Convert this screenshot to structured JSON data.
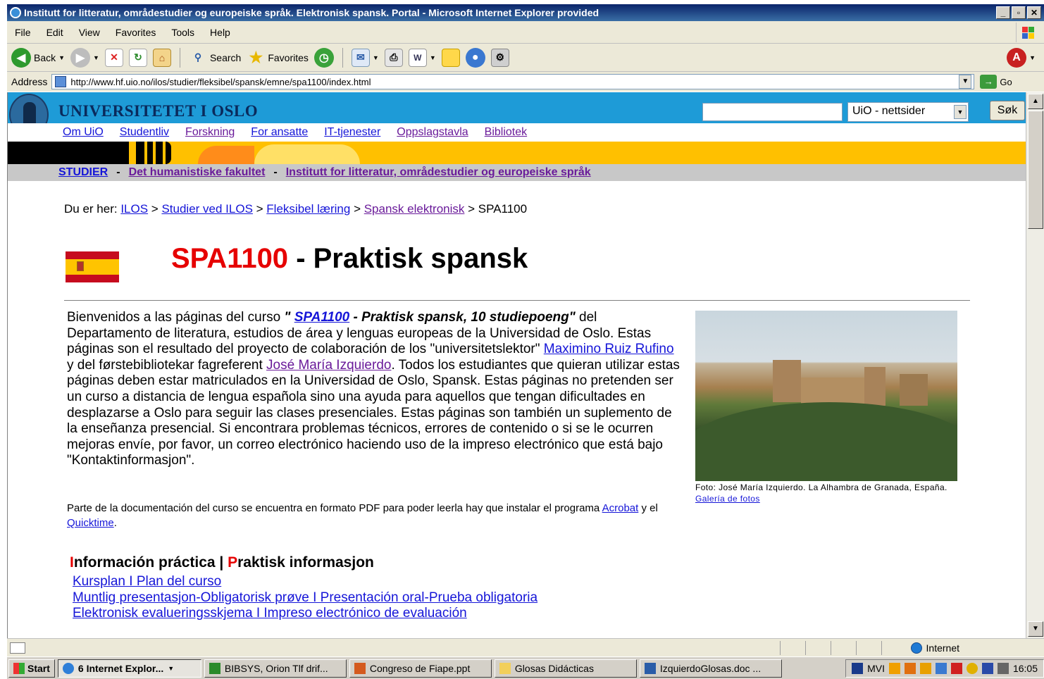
{
  "window": {
    "title": "Institutt for litteratur, områdestudier og europeiske språk. Elektronisk spansk. Portal - Microsoft Internet Explorer provided",
    "buttons": [
      "_",
      "▫",
      "✕"
    ]
  },
  "menu": [
    "File",
    "Edit",
    "View",
    "Favorites",
    "Tools",
    "Help"
  ],
  "toolbar": {
    "back": "Back",
    "search": "Search",
    "favorites": "Favorites"
  },
  "address": {
    "label": "Address",
    "url": "http://www.hf.uio.no/ilos/studier/fleksibel/spansk/emne/spa1100/index.html",
    "go": "Go"
  },
  "uio": {
    "name": "UNIVERSITETET I OSLO",
    "search_value": "",
    "scope": "UiO - nettsider",
    "search_button": "Søk",
    "nav": [
      "Om UiO",
      "Studentliv",
      "Forskning",
      "For ansatte",
      "IT-tjenester",
      "Oppslagstavla",
      "Bibliotek"
    ],
    "crumbs": {
      "studier": "STUDIER",
      "faculty": "Det humanistiske fakultet",
      "institute": "Institutt for litteratur, områdestudier og europeiske språk"
    }
  },
  "location": {
    "prefix": "Du er her:",
    "items": [
      "ILOS",
      "Studier ved ILOS",
      "Fleksibel læring",
      "Spansk elektronisk"
    ],
    "current": "SPA1100"
  },
  "course": {
    "code": "SPA1100",
    "name": "- Praktisk spansk"
  },
  "intro": {
    "p1a": "Bienvenidos a las páginas del curso ",
    "quote_open": "\" ",
    "code_link": "SPA1100",
    "quote_rest": " - Praktisk spansk, 10 studiepoeng\"",
    "p1b": " del Departamento de literatura, estudios de área y lenguas europeas de la Universidad de Oslo. Estas páginas son el resultado del proyecto de colaboración de los \"universitetslektor\" ",
    "person1": "Maximino Ruiz Rufino",
    "p1c": " y del førstebibliotekar fagreferent ",
    "person2": "José María Izquierdo",
    "p1d": ". Todos los estudiantes que quieran utilizar estas páginas deben estar matriculados en la Universidad de Oslo, Spansk. Estas páginas no pretenden ser un curso a distancia de lengua española sino una ayuda para aquellos que tengan dificultades en desplazarse a Oslo para seguir las clases presenciales. Estas páginas son también un suplemento de la enseñanza presencial. Si encontrara problemas técnicos, errores de contenido o si se le ocurren mejoras envíe, por favor, un correo electrónico haciendo uso de la impreso electrónico que está bajo \"Kontaktinformasjon\"."
  },
  "pdf": {
    "a": "Parte de la documentación del curso se encuentra en formato PDF para poder leerla hay que instalar el programa ",
    "acrobat": "Acrobat",
    "b": " y el ",
    "quicktime": "Quicktime",
    "c": "."
  },
  "photo": {
    "caption": "Foto: José María Izquierdo. La Alhambra de Granada, España. ",
    "gallery": "Galería de fotos"
  },
  "info": {
    "i1": "I",
    "h1": "nformación práctica | ",
    "p1": "P",
    "h2": "raktisk informasjon",
    "links": [
      "Kursplan I Plan del curso",
      "Muntlig presentasjon-Obligatorisk prøve I Presentación oral-Prueba obligatoria",
      "Elektronisk evalueringsskjema I Impreso electrónico de evaluación"
    ]
  },
  "status": {
    "zone": "Internet"
  },
  "taskbar": {
    "start": "Start",
    "tasks": [
      "6 Internet Explor...",
      "BIBSYS, Orion Tlf drif...",
      "Congreso de Fiape.ppt",
      "Glosas Didácticas",
      "IzquierdoGlosas.doc ..."
    ],
    "tray_label": "MVI",
    "clock": "16:05"
  },
  "colors": {
    "uio_blue": "#1e9bd7",
    "banner_yellow": "#ffc000",
    "course_red": "#e60000"
  }
}
